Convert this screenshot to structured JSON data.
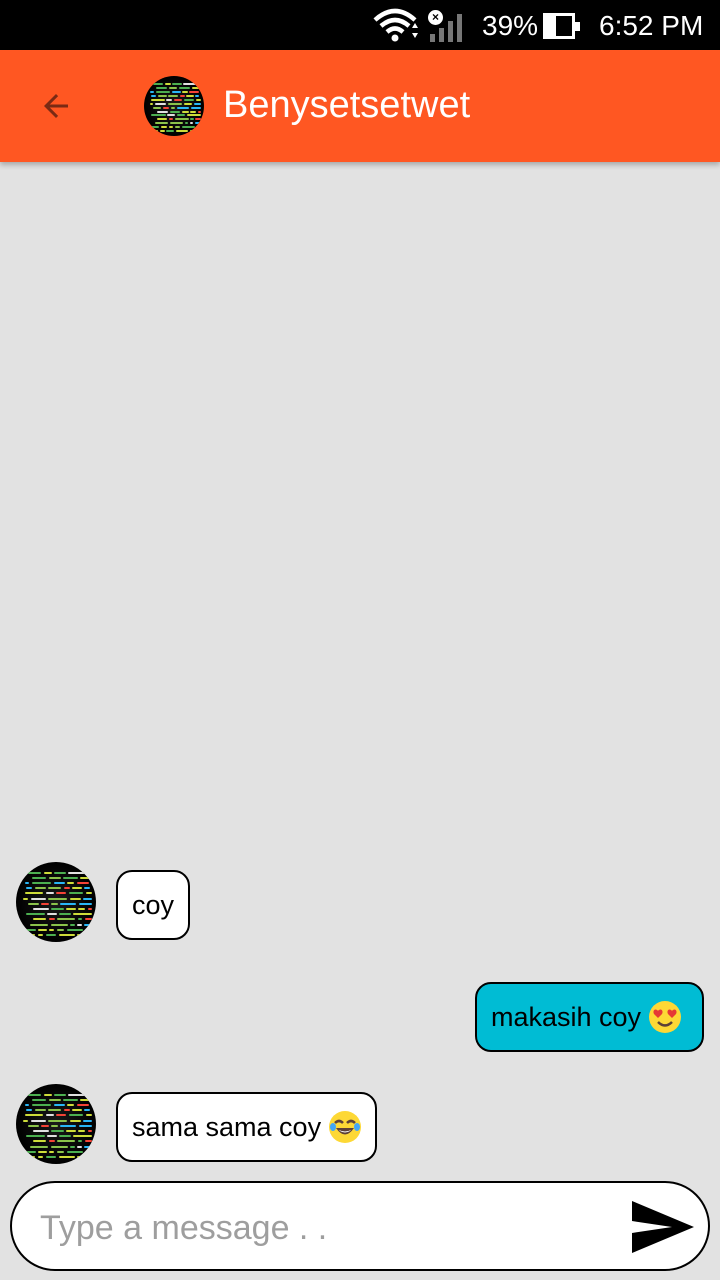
{
  "status_bar": {
    "battery_percent": "39%",
    "battery_level": 0.39,
    "time": "6:52 PM",
    "icons": [
      "wifi-icon",
      "no-sim-icon",
      "signal-icon",
      "battery-icon"
    ]
  },
  "header": {
    "title": "Benysetsetwet",
    "back_icon": "arrow-back-icon",
    "avatar": "contact-avatar"
  },
  "messages": [
    {
      "direction": "incoming",
      "text": "coy",
      "emoji": ""
    },
    {
      "direction": "outgoing",
      "text": "makasih coy",
      "emoji": "smiling-face-with-heart-eyes"
    },
    {
      "direction": "incoming",
      "text": "sama sama coy",
      "emoji": "face-with-tears-of-joy"
    }
  ],
  "composer": {
    "placeholder": "Type a message . .",
    "value": "",
    "send_icon": "send-icon"
  },
  "colors": {
    "app_bar": "#ff5722",
    "background": "#e2e2e2",
    "outgoing_bubble": "#00bcd4",
    "incoming_bubble": "#ffffff",
    "back_arrow": "#7a2a14"
  }
}
